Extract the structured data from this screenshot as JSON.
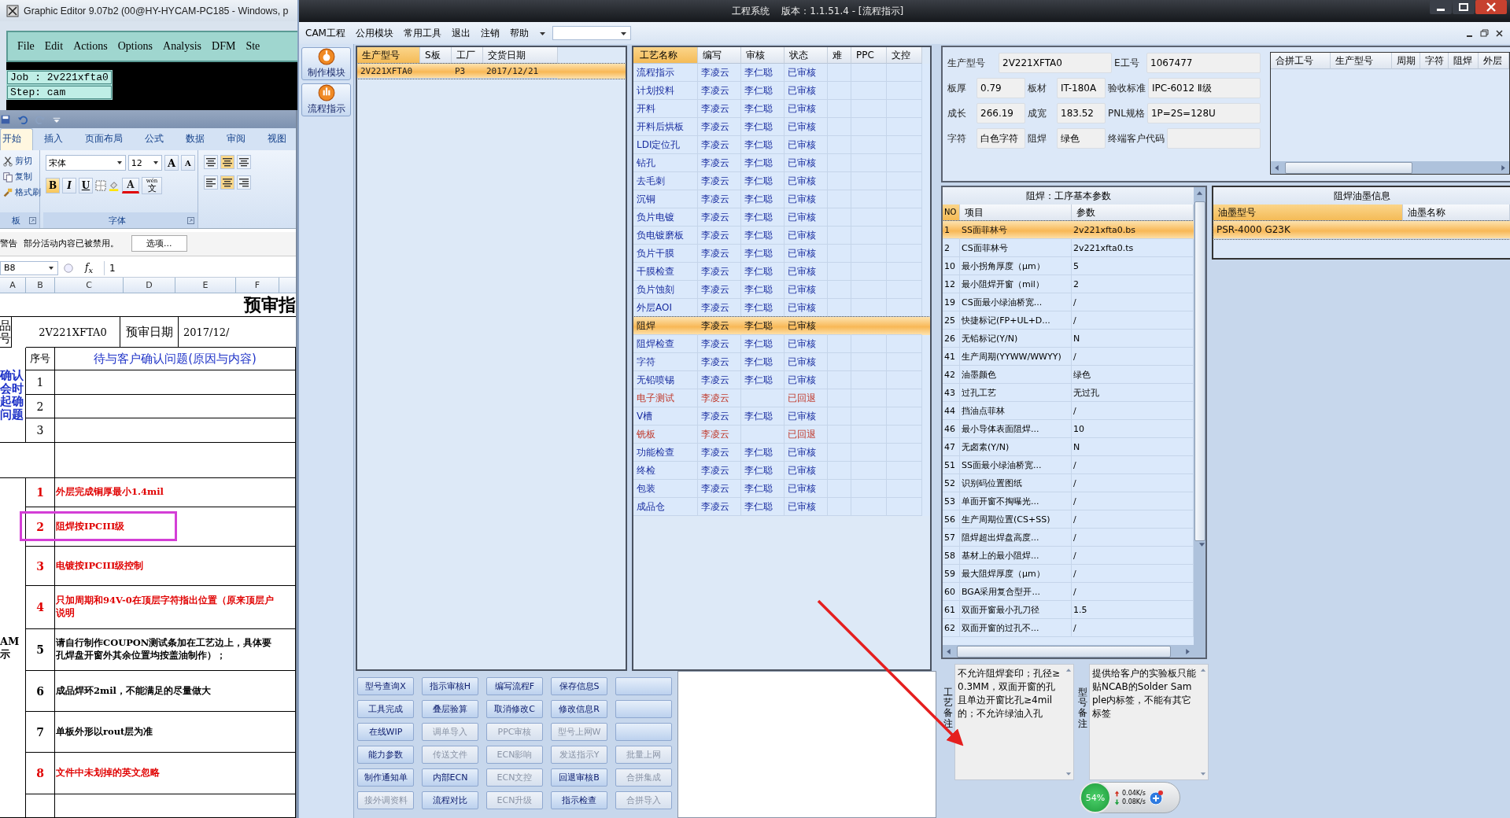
{
  "graphic_editor": {
    "title": "Graphic Editor 9.07b2 (00@HY-HYCAM-PC185 - Windows, p",
    "menu": [
      "File",
      "Edit",
      "Actions",
      "Options",
      "Analysis",
      "DFM",
      "Ste"
    ],
    "job": "Job : 2v221xfta0",
    "step": "Step: cam"
  },
  "spreadsheet": {
    "tabs": [
      {
        "label": "开始",
        "selected": true
      },
      {
        "label": "插入",
        "selected": false
      },
      {
        "label": "页面布局",
        "selected": false
      },
      {
        "label": "公式",
        "selected": false
      },
      {
        "label": "数据",
        "selected": false
      },
      {
        "label": "审阅",
        "selected": false
      },
      {
        "label": "视图",
        "selected": false
      }
    ],
    "clipboard_items": [
      "剪切",
      "复制",
      "格式刷"
    ],
    "clipboard_group": "板",
    "font_name": "宋体",
    "font_size": "12",
    "size_buttons": [
      "A",
      "A"
    ],
    "style_buttons": [
      "B",
      "I",
      "U"
    ],
    "color_button": "A",
    "phonetic_top": "wén",
    "phonetic_char": "文",
    "font_group": "字体",
    "warning_label": "警告",
    "warning_text": "部分活动内容已被禁用。",
    "options_button": "选项...",
    "name_box": "B8",
    "function_label": "f$_{x}$",
    "formula": "1",
    "columns": [
      "A",
      "B",
      "C",
      "D",
      "E",
      "F"
    ],
    "title": "预审指",
    "product_label": "品号",
    "product_value": "2V221XFTA0",
    "date_label": "预审日期",
    "date_value": "2017/12/",
    "question_label": "确认会时起确问题",
    "no_heading": "序号",
    "question_heading": "待与客户确认问题(原因与内容)",
    "questions": [
      {
        "no": "1"
      },
      {
        "no": "2"
      },
      {
        "no": "3"
      }
    ],
    "section_label": "AM示",
    "items": [
      {
        "no": "1",
        "text": "外层完成铜厚最小1.4mil",
        "important": true,
        "highlighted": false
      },
      {
        "no": "2",
        "text": "阻焊按IPCIII级",
        "important": true,
        "highlighted": true
      },
      {
        "no": "3",
        "text": "电镀按IPCIII级控制",
        "important": true,
        "highlighted": false
      },
      {
        "no": "4",
        "text": "只加周期和94V-0在顶层字符指出位置（原来顶层户说明",
        "important": true,
        "highlighted": false
      },
      {
        "no": "5",
        "text": "请自行制作COUPON测试条加在工艺边上，具体要孔焊盘开窗外其余位置均按盖油制作）；",
        "important": false,
        "highlighted": false
      },
      {
        "no": "6",
        "text": "成品焊环2mil，不能满足的尽量做大",
        "important": false,
        "highlighted": false
      },
      {
        "no": "7",
        "text": "单板外形以rout层为准",
        "important": false,
        "highlighted": false
      },
      {
        "no": "8",
        "text": "文件中未划掉的英文忽略",
        "important": true,
        "highlighted": false
      }
    ]
  },
  "app": {
    "title": "工程系统    版本：1.1.51.4 - [流程指示]",
    "menu": [
      "CAM工程",
      "公用模块",
      "常用工具",
      "退出",
      "注销",
      "帮助"
    ],
    "tools": [
      {
        "label": "制作模块"
      },
      {
        "label": "流程指示"
      }
    ],
    "orders": {
      "columns": [
        {
          "label": "生产型号",
          "sorted": true
        },
        {
          "label": "S板",
          "sorted": false
        },
        {
          "label": "工厂",
          "sorted": false
        },
        {
          "label": "交货日期",
          "sorted": false
        }
      ],
      "rows": [
        {
          "model": "2V221XFTA0",
          "factory": "P3",
          "delivery": "2017/12/21",
          "selected": true
        }
      ]
    },
    "process": {
      "columns": [
        {
          "label": "工艺名称",
          "sorted": true
        },
        {
          "label": "编写",
          "sorted": false
        },
        {
          "label": "审核",
          "sorted": false
        },
        {
          "label": "状态",
          "sorted": false
        },
        {
          "label": "难",
          "sorted": false
        },
        {
          "label": "PPC",
          "sorted": false
        },
        {
          "label": "文控",
          "sorted": false
        }
      ],
      "rows": [
        {
          "name": "流程指示",
          "writer": "李凌云",
          "reviewer": "李仁聪",
          "status": "已审核",
          "returned": false,
          "selected": false
        },
        {
          "name": "计划投料",
          "writer": "李凌云",
          "reviewer": "李仁聪",
          "status": "已审核",
          "returned": false,
          "selected": false
        },
        {
          "name": "开料",
          "writer": "李凌云",
          "reviewer": "李仁聪",
          "status": "已审核",
          "returned": false,
          "selected": false
        },
        {
          "name": "开料后烘板",
          "writer": "李凌云",
          "reviewer": "李仁聪",
          "status": "已审核",
          "returned": false,
          "selected": false
        },
        {
          "name": "LDI定位孔",
          "writer": "李凌云",
          "reviewer": "李仁聪",
          "status": "已审核",
          "returned": false,
          "selected": false
        },
        {
          "name": "钻孔",
          "writer": "李凌云",
          "reviewer": "李仁聪",
          "status": "已审核",
          "returned": false,
          "selected": false
        },
        {
          "name": "去毛刺",
          "writer": "李凌云",
          "reviewer": "李仁聪",
          "status": "已审核",
          "returned": false,
          "selected": false
        },
        {
          "name": "沉铜",
          "writer": "李凌云",
          "reviewer": "李仁聪",
          "status": "已审核",
          "returned": false,
          "selected": false
        },
        {
          "name": "负片电镀",
          "writer": "李凌云",
          "reviewer": "李仁聪",
          "status": "已审核",
          "returned": false,
          "selected": false
        },
        {
          "name": "负电镀磨板",
          "writer": "李凌云",
          "reviewer": "李仁聪",
          "status": "已审核",
          "returned": false,
          "selected": false
        },
        {
          "name": "负片干膜",
          "writer": "李凌云",
          "reviewer": "李仁聪",
          "status": "已审核",
          "returned": false,
          "selected": false
        },
        {
          "name": "干膜检查",
          "writer": "李凌云",
          "reviewer": "李仁聪",
          "status": "已审核",
          "returned": false,
          "selected": false
        },
        {
          "name": "负片蚀刻",
          "writer": "李凌云",
          "reviewer": "李仁聪",
          "status": "已审核",
          "returned": false,
          "selected": false
        },
        {
          "name": "外层AOI",
          "writer": "李凌云",
          "reviewer": "李仁聪",
          "status": "已审核",
          "returned": false,
          "selected": false
        },
        {
          "name": "阻焊",
          "writer": "李凌云",
          "reviewer": "李仁聪",
          "status": "已审核",
          "returned": false,
          "selected": true
        },
        {
          "name": "阻焊检查",
          "writer": "李凌云",
          "reviewer": "李仁聪",
          "status": "已审核",
          "returned": false,
          "selected": false
        },
        {
          "name": "字符",
          "writer": "李凌云",
          "reviewer": "李仁聪",
          "status": "已审核",
          "returned": false,
          "selected": false
        },
        {
          "name": "无铅喷锡",
          "writer": "李凌云",
          "reviewer": "李仁聪",
          "status": "已审核",
          "returned": false,
          "selected": false
        },
        {
          "name": "电子测试",
          "writer": "李凌云",
          "status": "已回退",
          "returned": true,
          "selected": false
        },
        {
          "name": "V槽",
          "writer": "李凌云",
          "reviewer": "李仁聪",
          "status": "已审核",
          "returned": false,
          "selected": false
        },
        {
          "name": "铣板",
          "writer": "李凌云",
          "status": "已回退",
          "returned": true,
          "selected": false
        },
        {
          "name": "功能检查",
          "writer": "李凌云",
          "reviewer": "李仁聪",
          "status": "已审核",
          "returned": false,
          "selected": false
        },
        {
          "name": "终检",
          "writer": "李凌云",
          "reviewer": "李仁聪",
          "status": "已审核",
          "returned": false,
          "selected": false
        },
        {
          "name": "包装",
          "writer": "李凌云",
          "reviewer": "李仁聪",
          "status": "已审核",
          "returned": false,
          "selected": false
        },
        {
          "name": "成品仓",
          "writer": "李凌云",
          "reviewer": "李仁聪",
          "status": "已审核",
          "returned": false,
          "selected": false
        }
      ]
    },
    "info": [
      [
        {
          "label": "生产型号",
          "value": "2V221XFTA0"
        },
        {
          "label": "E工号",
          "value": "1067477"
        }
      ],
      [
        {
          "label": "板厚",
          "value": "0.79"
        },
        {
          "label": "板材",
          "value": "IT-180A"
        },
        {
          "label": "验收标准",
          "value": "IPC-6012 Ⅱ级"
        }
      ],
      [
        {
          "label": "成长",
          "value": "266.19"
        },
        {
          "label": "成宽",
          "value": "183.52"
        },
        {
          "label": "PNL规格",
          "value": "1P=2S=128U"
        }
      ],
      [
        {
          "label": "字符",
          "value": "白色字符"
        },
        {
          "label": "阻焊",
          "value": "绿色"
        },
        {
          "label": "终端客户代码"
        }
      ]
    ],
    "merge_columns": [
      "合拼工号",
      "生产型号",
      "周期",
      "字符",
      "阻焊",
      "外层"
    ],
    "params": {
      "title": "阻焊：工序基本参数",
      "columns": [
        {
          "label": "NO",
          "sorted": true
        },
        {
          "label": "项目",
          "sorted": false
        },
        {
          "label": "参数",
          "sorted": false
        }
      ],
      "rows": [
        {
          "no": "1",
          "item": "SS面菲林号",
          "value": "2v221xfta0.bs",
          "selected": true
        },
        {
          "no": "2",
          "item": "CS面菲林号",
          "value": "2v221xfta0.ts",
          "selected": false
        },
        {
          "no": "10",
          "item": "最小拐角厚度（μm）",
          "value": "5",
          "selected": false
        },
        {
          "no": "12",
          "item": "最小阻焊开窗（mil）",
          "value": "2",
          "selected": false
        },
        {
          "no": "19",
          "item": "CS面最小绿油桥宽...",
          "value": "/",
          "selected": false
        },
        {
          "no": "25",
          "item": "快捷标记(FP+UL+D...",
          "value": "/",
          "selected": false
        },
        {
          "no": "26",
          "item": "无铅标记(Y/N)",
          "value": "N",
          "selected": false
        },
        {
          "no": "41",
          "item": "生产周期(YYWW/WWYY)",
          "value": "/",
          "selected": false
        },
        {
          "no": "42",
          "item": "油墨颜色",
          "value": "绿色",
          "selected": false
        },
        {
          "no": "43",
          "item": "过孔工艺",
          "value": "无过孔",
          "selected": false
        },
        {
          "no": "44",
          "item": "挡油点菲林",
          "value": "/",
          "selected": false
        },
        {
          "no": "46",
          "item": "最小导体表面阻焊...",
          "value": "10",
          "selected": false
        },
        {
          "no": "47",
          "item": "无卤素(Y/N)",
          "value": "N",
          "selected": false
        },
        {
          "no": "51",
          "item": "SS面最小绿油桥宽...",
          "value": "/",
          "selected": false
        },
        {
          "no": "52",
          "item": "识别码位置图纸",
          "value": "/",
          "selected": false
        },
        {
          "no": "53",
          "item": "单面开窗不掏曝光...",
          "value": "/",
          "selected": false
        },
        {
          "no": "56",
          "item": "生产周期位置(CS+SS)",
          "value": "/",
          "selected": false
        },
        {
          "no": "57",
          "item": "阻焊超出焊盘高度...",
          "value": "/",
          "selected": false
        },
        {
          "no": "58",
          "item": "基材上的最小阻焊...",
          "value": "/",
          "selected": false
        },
        {
          "no": "59",
          "item": "最大阻焊厚度（μm）",
          "value": "/",
          "selected": false
        },
        {
          "no": "60",
          "item": "BGA采用复合型开...",
          "value": "/",
          "selected": false
        },
        {
          "no": "61",
          "item": "双面开窗最小孔刀径",
          "value": "1.5",
          "selected": false
        },
        {
          "no": "62",
          "item": "双面开窗的过孔不...",
          "value": "/",
          "selected": false
        }
      ]
    },
    "ink": {
      "title": "阻焊油墨信息",
      "columns": [
        {
          "label": "油墨型号",
          "sorted": true
        },
        {
          "label": "油墨名称",
          "sorted": false
        }
      ],
      "rows": [
        {
          "model": "PSR-4000 G23K",
          "selected": true
        }
      ]
    },
    "buttons": [
      [
        {
          "label": "型号查询X",
          "disabled": false
        },
        {
          "label": "指示审核H",
          "disabled": false
        },
        {
          "label": "编写流程F",
          "disabled": false
        },
        {
          "label": "保存信息S",
          "disabled": false
        },
        {
          "disabled": false
        }
      ],
      [
        {
          "label": "工具完成",
          "disabled": false
        },
        {
          "label": "叠层验算",
          "disabled": false
        },
        {
          "label": "取消修改C",
          "disabled": false
        },
        {
          "label": "修改信息R",
          "disabled": false
        },
        {
          "disabled": false
        }
      ],
      [
        {
          "label": "在线WIP",
          "disabled": false
        },
        {
          "label": "调单导入",
          "disabled": true
        },
        {
          "label": "PPC审核",
          "disabled": true
        },
        {
          "label": "型号上网W",
          "disabled": true
        },
        {
          "disabled": false
        }
      ],
      [
        {
          "label": "能力参数",
          "disabled": false
        },
        {
          "label": "传送文件",
          "disabled": true
        },
        {
          "label": "ECN影响",
          "disabled": true
        },
        {
          "label": "发送指示Y",
          "disabled": true
        },
        {
          "label": "批量上网",
          "disabled": true
        }
      ],
      [
        {
          "label": "制作通知单",
          "disabled": false
        },
        {
          "label": "内部ECN",
          "disabled": false
        },
        {
          "label": "ECN文控",
          "disabled": true
        },
        {
          "label": "回退审核B",
          "disabled": false
        },
        {
          "label": "合拼集成",
          "disabled": true
        }
      ],
      [
        {
          "label": "接外调资料",
          "disabled": true
        },
        {
          "label": "流程对比",
          "disabled": false
        },
        {
          "label": "ECN升级",
          "disabled": true
        },
        {
          "label": "指示检查",
          "disabled": false
        },
        {
          "label": "合拼导入",
          "disabled": true
        }
      ]
    ],
    "remarks": [
      {
        "label": "工艺备注",
        "text": "不允许阻焊套印；孔径≥0.3MM，双面开窗的孔且单边开窗比孔≥4mil的；不允许绿油入孔"
      },
      {
        "label": "型号备注",
        "text": "提供给客户的实验板只能贴NCAB的Solder Sample内标签，不能有其它标签"
      }
    ],
    "network": {
      "percent": "54%",
      "up": "0.04K/s",
      "down": "0.08K/s"
    }
  }
}
